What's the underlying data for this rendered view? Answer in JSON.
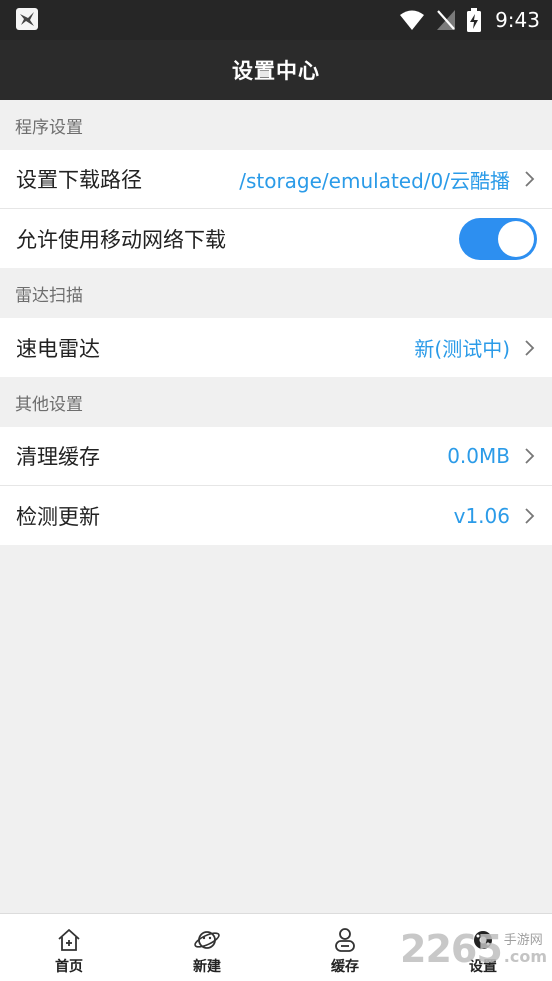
{
  "status_bar": {
    "time": "9:43",
    "icons": [
      "app-notification-icon",
      "wifi-icon",
      "no-signal-icon",
      "battery-charging-icon"
    ]
  },
  "header": {
    "title": "设置中心"
  },
  "sections": [
    {
      "title": "程序设置",
      "items": [
        {
          "label": "设置下载路径",
          "value": "/storage/emulated/0/云酷播"
        },
        {
          "label": "允许使用移动网络下载",
          "toggle_on": true
        }
      ]
    },
    {
      "title": "雷达扫描",
      "items": [
        {
          "label": "速电雷达",
          "value": "新(测试中)"
        }
      ]
    },
    {
      "title": "其他设置",
      "items": [
        {
          "label": "清理缓存",
          "value": "0.0MB"
        },
        {
          "label": "检测更新",
          "value": "v1.06"
        }
      ]
    }
  ],
  "bottom_nav": [
    {
      "label": "首页",
      "icon": "home-icon"
    },
    {
      "label": "新建",
      "icon": "planet-icon"
    },
    {
      "label": "缓存",
      "icon": "user-download-icon"
    },
    {
      "label": "设置",
      "icon": "gear-icon",
      "active": true
    }
  ],
  "watermark": {
    "number": "2265",
    "chinese": "手游网",
    "suffix": ".com"
  },
  "colors": {
    "status_bar": "#262626",
    "title_bar": "#2b2b2b",
    "value_text": "#2b9be8",
    "toggle_on": "#2d8ff0",
    "page_background": "#f0f0f0"
  }
}
